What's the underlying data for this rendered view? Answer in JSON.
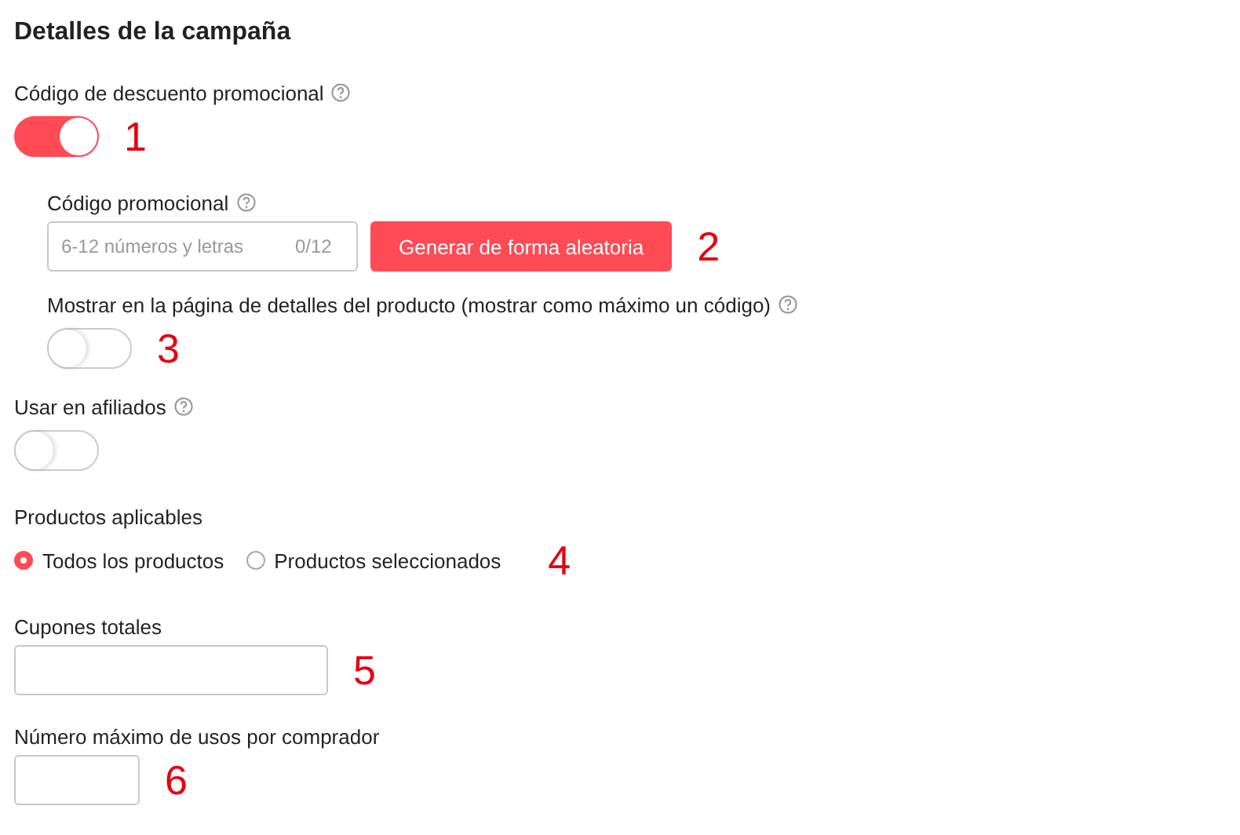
{
  "title": "Detalles de la campaña",
  "fields": [
    {
      "kind": "toggle",
      "label": "Código de descuento promocional",
      "help": true,
      "on": true,
      "marker": "1",
      "children": [
        {
          "kind": "code_input",
          "label": "Código promocional",
          "help": true,
          "placeholder": "6-12 números y letras",
          "counter": "0/12",
          "button": "Generar de forma aleatoria",
          "marker": "2"
        },
        {
          "kind": "toggle",
          "label": "Mostrar en la página de detalles del producto (mostrar como máximo un código)",
          "help": true,
          "on": false,
          "marker": "3"
        }
      ]
    },
    {
      "kind": "toggle",
      "label": "Usar en afiliados",
      "help": true,
      "on": false
    },
    {
      "kind": "radio",
      "label": "Productos aplicables",
      "help": false,
      "marker": "4",
      "options": [
        {
          "label": "Todos los productos",
          "selected": true
        },
        {
          "label": "Productos seleccionados",
          "selected": false
        }
      ]
    },
    {
      "kind": "input",
      "label": "Cupones totales",
      "help": false,
      "marker": "5"
    },
    {
      "kind": "small_input",
      "label": "Número máximo de usos por comprador",
      "help": false,
      "marker": "6"
    }
  ]
}
